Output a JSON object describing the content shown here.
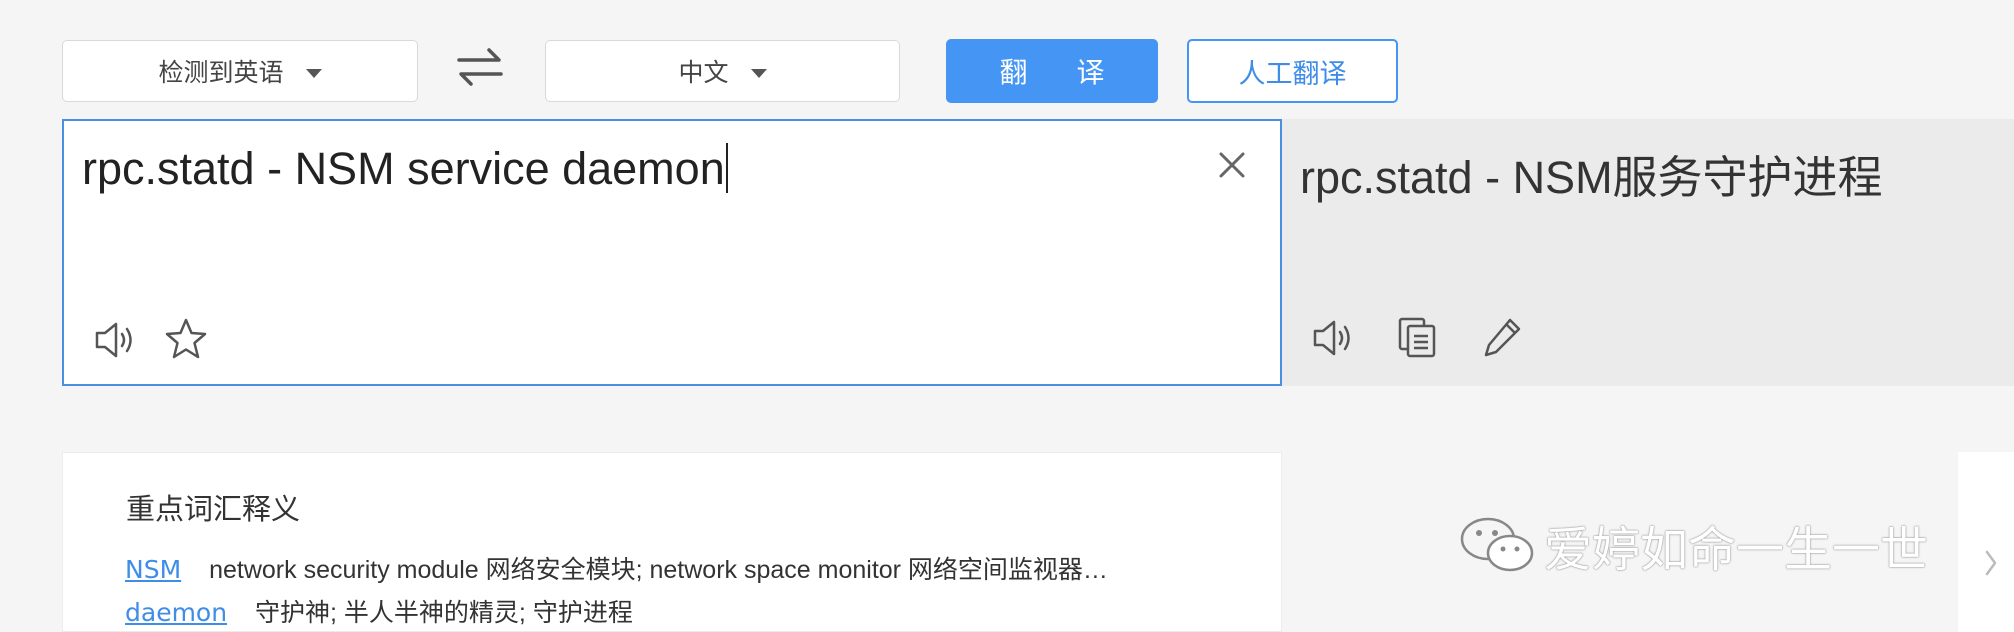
{
  "toolbar": {
    "source_language": "检测到英语",
    "target_language": "中文",
    "translate_label": "翻 译",
    "human_translate_label": "人工翻译"
  },
  "input": {
    "text": "rpc.statd - NSM service daemon"
  },
  "output": {
    "text": "rpc.statd - NSM服务守护进程"
  },
  "vocabulary": {
    "title": "重点词汇释义",
    "items": [
      {
        "word": "NSM",
        "definition": "network security module 网络安全模块; network space monitor 网络空间监视器…"
      },
      {
        "word": "daemon",
        "definition": "守护神; 半人半神的精灵; 守护进程"
      }
    ]
  },
  "watermark": {
    "text": "爱婷如命一生一世"
  },
  "colors": {
    "accent": "#4596f4",
    "link": "#3f8de8",
    "input_border": "#4a90e2",
    "output_bg": "#ebebeb",
    "page_bg": "#f5f5f5"
  },
  "icons": [
    "caret-down-icon",
    "swap-icon",
    "close-icon",
    "speaker-icon",
    "star-icon",
    "copy-icon",
    "pencil-icon",
    "wechat-icon",
    "chevron-right-icon"
  ]
}
